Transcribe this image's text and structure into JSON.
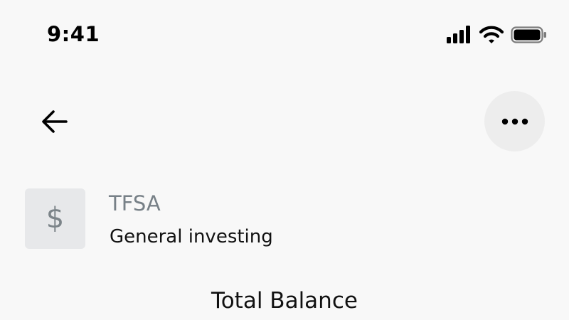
{
  "status_bar": {
    "time": "9:41",
    "icons": [
      "cellular-signal-icon",
      "wifi-icon",
      "battery-icon"
    ]
  },
  "nav": {
    "back_icon": "arrow-left-icon",
    "more_icon": "more-horizontal-icon"
  },
  "account": {
    "icon_glyph": "$",
    "type": "TFSA",
    "name": "General investing"
  },
  "balance": {
    "label": "Total Balance"
  },
  "colors": {
    "background": "#f8f8f8",
    "icon_tile": "#e7e8ea",
    "more_button_bg": "#ededed",
    "secondary_text": "#778087"
  }
}
